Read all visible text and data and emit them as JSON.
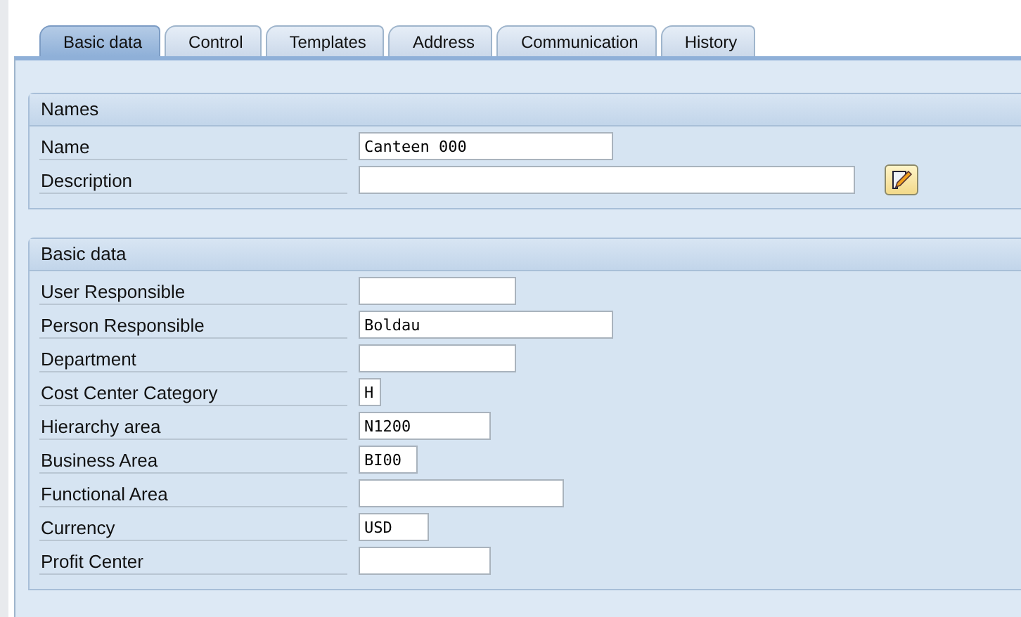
{
  "tabs": [
    {
      "label": "Basic data",
      "selected": true
    },
    {
      "label": "Control",
      "selected": false
    },
    {
      "label": "Templates",
      "selected": false
    },
    {
      "label": "Address",
      "selected": false
    },
    {
      "label": "Communication",
      "selected": false
    },
    {
      "label": "History",
      "selected": false
    }
  ],
  "groups": [
    {
      "title": "Names",
      "fields": [
        {
          "label": "Name",
          "value": "Canteen 000"
        },
        {
          "label": "Description",
          "edit_button": true
        }
      ]
    },
    {
      "title": "Basic data",
      "fields": [
        {
          "label": "User Responsible"
        },
        {
          "label": "Person Responsible",
          "value": "Boldau"
        },
        {
          "label": "Department"
        },
        {
          "label": "Cost Center Category",
          "value": "H"
        },
        {
          "label": "Hierarchy area",
          "value": "N1200"
        },
        {
          "label": "Business Area",
          "value": "BI00"
        },
        {
          "label": "Functional Area"
        },
        {
          "label": "Currency",
          "value": "USD"
        },
        {
          "label": "Profit Center"
        }
      ]
    }
  ]
}
